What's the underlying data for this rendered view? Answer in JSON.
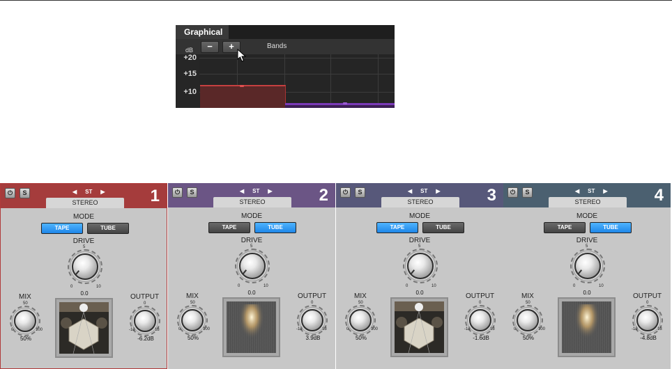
{
  "graphical": {
    "tab": "Graphical",
    "minus_label": "−",
    "plus_label": "+",
    "bands_label": "Bands",
    "db_unit": "dB",
    "y_ticks": [
      "+20",
      "+15",
      "+10"
    ]
  },
  "modules": [
    {
      "number": "1",
      "header_color": "#a53c3c",
      "selected": true,
      "stereo": "STEREO",
      "st": "ST",
      "mode_label": "MODE",
      "tape": "TAPE",
      "tube": "TUBE",
      "mode": "tape",
      "drive_label": "DRIVE",
      "drive_value": "0.0",
      "drive_scale": [
        "5",
        "0",
        "10"
      ],
      "mix_label": "MIX",
      "mix_value": "50%",
      "mix_scale": [
        "50",
        "0",
        "100"
      ],
      "output_label": "OUTPUT",
      "output_value": "-6.2dB",
      "output_scale": [
        "0",
        "-13",
        "13"
      ]
    },
    {
      "number": "2",
      "header_color": "#6b5585",
      "selected": false,
      "stereo": "STEREO",
      "st": "ST",
      "mode_label": "MODE",
      "tape": "TAPE",
      "tube": "TUBE",
      "mode": "tube",
      "drive_label": "DRIVE",
      "drive_value": "0.0",
      "drive_scale": [
        "5",
        "0",
        "10"
      ],
      "mix_label": "MIX",
      "mix_value": "50%",
      "mix_scale": [
        "50",
        "0",
        "100"
      ],
      "output_label": "OUTPUT",
      "output_value": "3.9dB",
      "output_scale": [
        "0",
        "-13",
        "13"
      ]
    },
    {
      "number": "3",
      "header_color": "#57587a",
      "selected": false,
      "stereo": "STEREO",
      "st": "ST",
      "mode_label": "MODE",
      "tape": "TAPE",
      "tube": "TUBE",
      "mode": "tape",
      "drive_label": "DRIVE",
      "drive_value": "0.0",
      "drive_scale": [
        "5",
        "0",
        "10"
      ],
      "mix_label": "MIX",
      "mix_value": "50%",
      "mix_scale": [
        "50",
        "0",
        "100"
      ],
      "output_label": "OUTPUT",
      "output_value": "-1.6dB",
      "output_scale": [
        "0",
        "-13",
        "13"
      ]
    },
    {
      "number": "4",
      "header_color": "#4b6070",
      "selected": false,
      "stereo": "STEREO",
      "st": "ST",
      "mode_label": "MODE",
      "tape": "TAPE",
      "tube": "TUBE",
      "mode": "tube",
      "drive_label": "DRIVE",
      "drive_value": "0.0",
      "drive_scale": [
        "5",
        "0",
        "10"
      ],
      "mix_label": "MIX",
      "mix_value": "50%",
      "mix_scale": [
        "50",
        "0",
        "100"
      ],
      "output_label": "OUTPUT",
      "output_value": "-4.8dB",
      "output_scale": [
        "0",
        "-13",
        "13"
      ]
    }
  ]
}
